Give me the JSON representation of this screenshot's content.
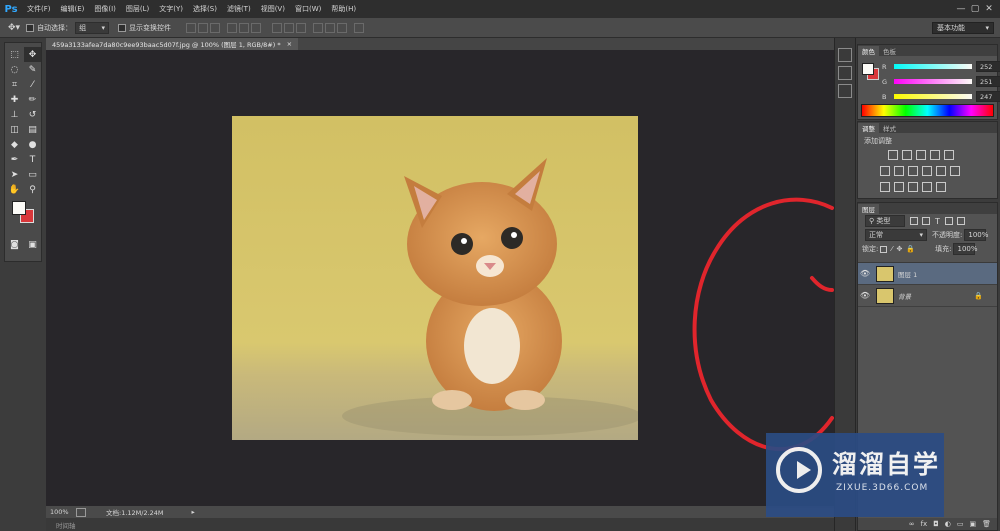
{
  "menu": {
    "logo": "Ps",
    "items": [
      "文件(F)",
      "编辑(E)",
      "图像(I)",
      "图层(L)",
      "文字(Y)",
      "选择(S)",
      "滤镜(T)",
      "视图(V)",
      "窗口(W)",
      "帮助(H)"
    ]
  },
  "options": {
    "auto_select_label": "自动选择：",
    "auto_select_value": "组",
    "show_transform_label": "显示变换控件",
    "workspace": "基本功能"
  },
  "document": {
    "tab_title": "459a3133afea7da80c9ee93baac5d07f.jpg @ 100% (图层 1, RGB/8#) *",
    "tab_close": "×"
  },
  "status": {
    "zoom": "100%",
    "doc_size": "文档:1.12M/2.24M",
    "timeline": "时间轴"
  },
  "color_panel": {
    "tabs": [
      "颜色",
      "色板"
    ],
    "r_label": "R",
    "r_value": "252",
    "g_label": "G",
    "g_value": "251",
    "b_label": "B",
    "b_value": "247",
    "foreground_color": "#fcfbf7",
    "background_color": "#d9373a"
  },
  "adjust_panel": {
    "tabs": [
      "调整",
      "样式"
    ],
    "title": "添加调整"
  },
  "layers_panel": {
    "tabs": [
      "图层"
    ],
    "filter": "类型",
    "blend_mode": "正常",
    "opacity_label": "不透明度:",
    "opacity_value": "100%",
    "lock_label": "锁定:",
    "fill_label": "填充:",
    "fill_value": "100%",
    "layers": [
      {
        "name": "图层 1",
        "selected": true
      },
      {
        "name": "背景",
        "selected": false,
        "locked": true
      }
    ]
  },
  "watermark": {
    "title": "溜溜自学",
    "url": "ZIXUE.3D66.COM"
  },
  "annotation": {
    "color": "#e0252c"
  }
}
